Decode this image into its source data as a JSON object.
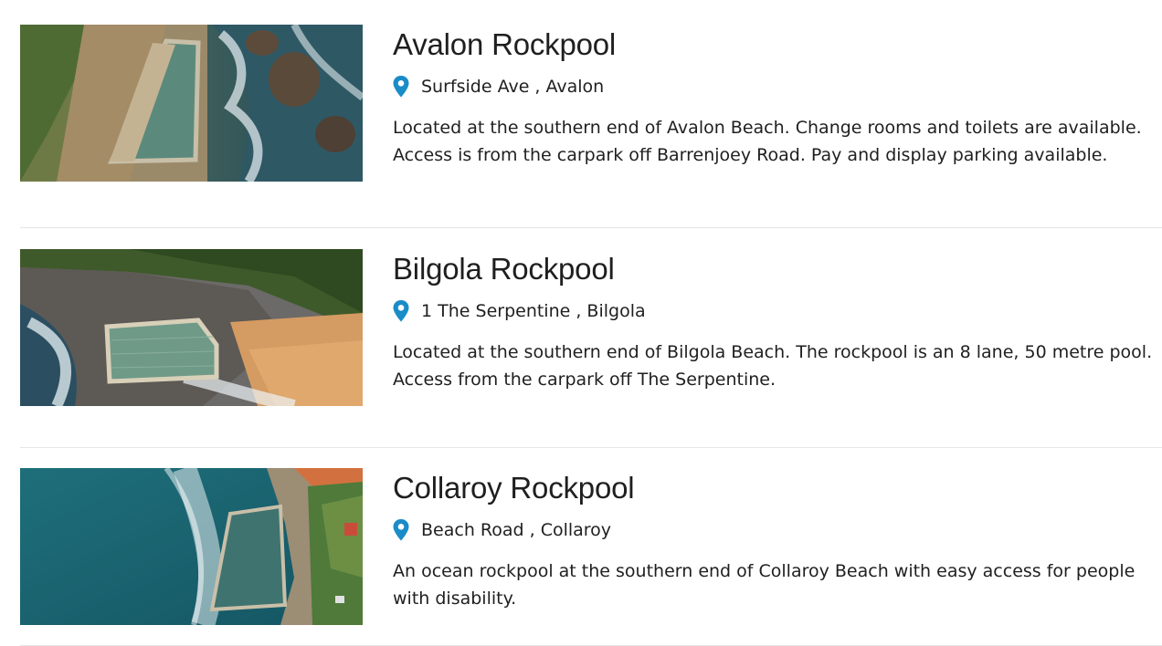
{
  "pools": [
    {
      "title": "Avalon Rockpool",
      "address": "Surfside Ave , Avalon",
      "description": "Located at the southern end of Avalon Beach. Change rooms and toilets are available. Access is from the carpark off Barrenjoey Road. Pay and display parking available.",
      "image_icon": "aerial-photo-avalon-rockpool"
    },
    {
      "title": "Bilgola Rockpool",
      "address": "1 The Serpentine , Bilgola",
      "description": "Located at the southern end of Bilgola Beach. The rockpool is an 8 lane, 50 metre pool. Access from the carpark off The Serpentine.",
      "image_icon": "aerial-photo-bilgola-rockpool"
    },
    {
      "title": "Collaroy Rockpool",
      "address": "Beach Road , Collaroy",
      "description": "An ocean rockpool at the southern end of Collaroy Beach with easy access for people with disability.",
      "image_icon": "aerial-photo-collaroy-rockpool"
    }
  ],
  "colors": {
    "pin": "#1a8cc7",
    "divider": "#e6e6e6",
    "text": "#1f1f1f"
  }
}
